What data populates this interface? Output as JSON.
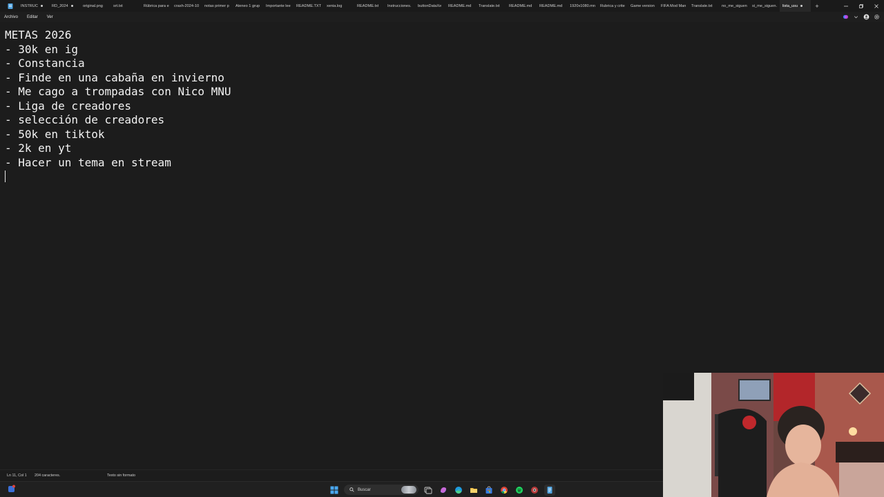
{
  "tabbar": {
    "tabs": [
      {
        "label": "INSTRUC",
        "dot": true
      },
      {
        "label": "RD_2024",
        "dot": true
      },
      {
        "label": "original.png",
        "dot": false
      },
      {
        "label": "srt.txt",
        "dot": false
      },
      {
        "label": "Rúbrica para e",
        "dot": false
      },
      {
        "label": "crash-2024-10",
        "dot": false
      },
      {
        "label": "notas primer p",
        "dot": false
      },
      {
        "label": "Ateneo 1 grup",
        "dot": false
      },
      {
        "label": "Importante lee",
        "dot": false
      },
      {
        "label": "README.TXT",
        "dot": false
      },
      {
        "label": "xenia.log",
        "dot": false
      },
      {
        "label": "README.txt",
        "dot": false
      },
      {
        "label": "Instrucciones.",
        "dot": false
      },
      {
        "label": "buttonDataXe",
        "dot": false
      },
      {
        "label": "README.md",
        "dot": false
      },
      {
        "label": "Translate.txt",
        "dot": false
      },
      {
        "label": "README.md",
        "dot": false
      },
      {
        "label": "README.md",
        "dot": false
      },
      {
        "label": "1920x1080.mn",
        "dot": false
      },
      {
        "label": "Rubrica y crite",
        "dot": false
      },
      {
        "label": "Game version",
        "dot": false
      },
      {
        "label": "FIFA Mod Man",
        "dot": false
      },
      {
        "label": "Translate.txt",
        "dot": false
      },
      {
        "label": "no_me_siguen",
        "dot": false
      },
      {
        "label": "si_me_siguen.",
        "dot": false
      },
      {
        "label": "lista_usu",
        "dot": true,
        "active": true
      }
    ],
    "new_tab_label": "+"
  },
  "menubar": {
    "file": "Archivo",
    "edit": "Editar",
    "view": "Ver"
  },
  "editor": {
    "lines": [
      "METAS 2026",
      "- 30k en ig",
      "- Constancia",
      "- Finde en una cabaña en invierno",
      "- Me cago a trompadas con Nico MNU",
      "- Liga de creadores",
      "- selección de creadores",
      "- 50k en tiktok",
      "- 2k en yt",
      "- Hacer un tema en stream",
      ""
    ]
  },
  "statusbar": {
    "position": "Ln 11, Col 1",
    "characters": "204 caracteres.",
    "format": "Texto sin formato"
  },
  "taskbar": {
    "search_label": "Buscar"
  },
  "colors": {
    "background": "#1c1c1c",
    "text": "#f2f2f2",
    "tabbar": "#1a1a1a",
    "active_tab": "#272727",
    "taskbar": "#202020"
  }
}
